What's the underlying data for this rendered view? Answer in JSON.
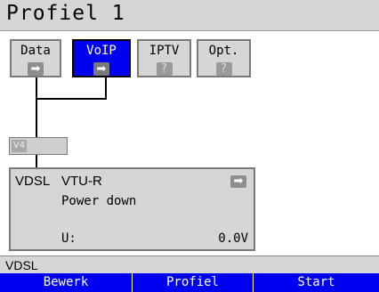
{
  "title": "Profiel 1",
  "tabs": [
    {
      "label": "Data",
      "icon": "arrow-right-icon",
      "glyph": "➡",
      "active": false
    },
    {
      "label": "VoIP",
      "icon": "arrow-right-icon",
      "glyph": "➡",
      "active": true
    },
    {
      "label": "IPTV",
      "icon": "question-icon",
      "glyph": "?",
      "active": false
    },
    {
      "label": "Opt.",
      "icon": "question-icon",
      "glyph": "?",
      "active": false
    }
  ],
  "protocol": {
    "tag": "V4"
  },
  "vdsl": {
    "name": "VDSL",
    "mode": "VTU-R",
    "state": "Power down",
    "voltage_label": "U:",
    "voltage_value": "0.0V",
    "icon": "arrow-right-icon",
    "glyph": "➡"
  },
  "status_bar": {
    "text": "VDSL"
  },
  "softkeys": [
    "Bewerk",
    "Profiel",
    "Start"
  ],
  "colors": {
    "accent": "#0000f0",
    "panel": "#d6d6d6",
    "border": "#7a7a7a"
  }
}
